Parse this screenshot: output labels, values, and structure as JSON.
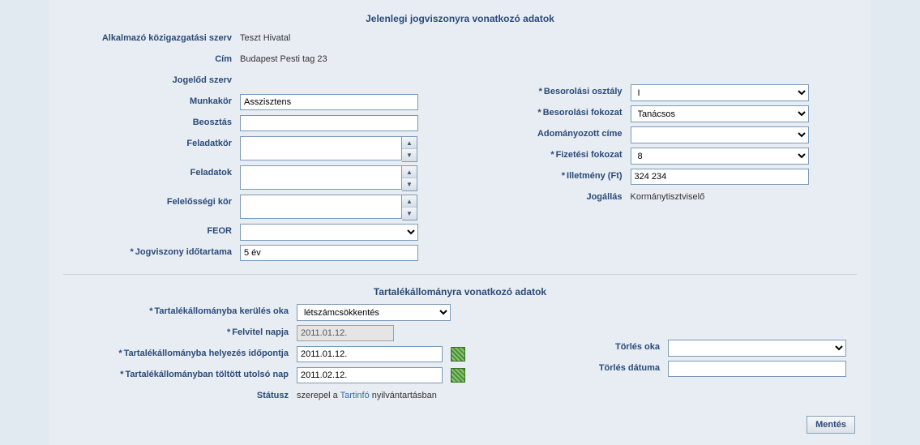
{
  "section1": {
    "title": "Jelenlegi jogviszonyra vonatkozó adatok",
    "left": {
      "org_label": "Alkalmazó közigazgatási szerv",
      "org_value": "Teszt Hivatal",
      "cim_label": "Cím",
      "cim_value": "Budapest Pesti tag 23",
      "jogelod_label": "Jogelőd szerv",
      "jogelod_value": "",
      "munkakor_label": "Munkakör",
      "munkakor_value": "Asszisztens",
      "beosztas_label": "Beosztás",
      "beosztas_value": "",
      "feladatkor_label": "Feladatkör",
      "feladatkor_value": "",
      "feladatok_label": "Feladatok",
      "feladatok_value": "",
      "felelosseg_label": "Felelősségi kör",
      "felelosseg_value": "",
      "feor_label": "FEOR",
      "feor_value": "",
      "idotartam_label": "Jogviszony időtartama",
      "idotartam_value": "5 év"
    },
    "right": {
      "besorolasi_osztaly_label": "Besorolási osztály",
      "besorolasi_osztaly_value": "I",
      "besorolasi_fokozat_label": "Besorolási fokozat",
      "besorolasi_fokozat_value": "Tanácsos",
      "adomany_label": "Adományozott címe",
      "adomany_value": "",
      "fizetesi_label": "Fizetési fokozat",
      "fizetesi_value": "8",
      "illetmeny_label": "Illetmény (Ft)",
      "illetmeny_value": "324 234",
      "jogallas_label": "Jogállás",
      "jogallas_value": "Kormánytisztviselő"
    }
  },
  "section2": {
    "title": "Tartalékállományra vonatkozó adatok",
    "left": {
      "kerules_label": "Tartalékállományba kerülés oka",
      "kerules_value": "létszámcsökkentés",
      "felvitel_label": "Felvitel napja",
      "felvitel_value": "2011.01.12.",
      "helyezes_label": "Tartalékállományba helyezés időpontja",
      "helyezes_value": "2011.01.12.",
      "utolso_label": "Tartalékállományban töltött utolsó nap",
      "utolso_value": "2011.02.12.",
      "statusz_label": "Státusz",
      "statusz_prefix": "szerepel a ",
      "statusz_link": "Tartinfó",
      "statusz_suffix": " nyilvántartásban"
    },
    "right": {
      "torles_oka_label": "Törlés oka",
      "torles_oka_value": "",
      "torles_datum_label": "Törlés dátuma",
      "torles_datum_value": ""
    }
  },
  "buttons": {
    "save": "Mentés"
  },
  "req_marker": "*"
}
